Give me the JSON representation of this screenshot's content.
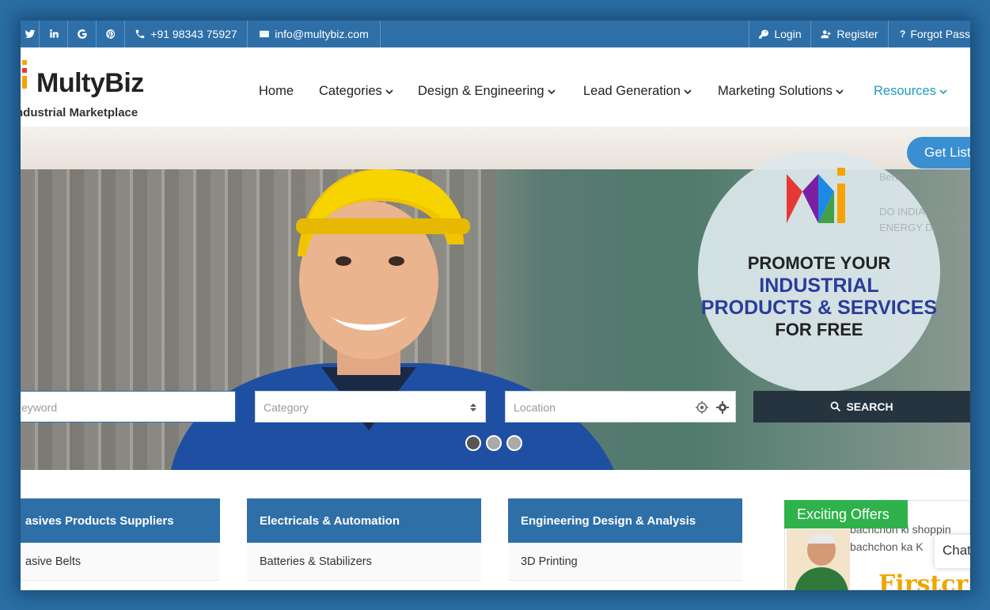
{
  "topbar": {
    "social": [
      "twitter-icon",
      "linkedin-icon",
      "google-icon",
      "pinterest-icon"
    ],
    "phone": "+91 98343 75927",
    "email": "info@multybiz.com",
    "login": "Login",
    "register": "Register",
    "forgot": "Forgot Pass"
  },
  "logo": {
    "title": "MultyBiz",
    "subtitle": "ndustrial Marketplace"
  },
  "nav": {
    "items": [
      "Home",
      "Categories",
      "Design & Engineering",
      "Lead Generation",
      "Marketing Solutions",
      "Resources"
    ]
  },
  "hero": {
    "promo": [
      "PROMOTE YOUR",
      "INDUSTRIAL",
      "PRODUCTS & SERVICES",
      "FOR FREE"
    ],
    "get_listed": "Get List",
    "faded": [
      "Benefit",
      "DO INDIA READY",
      "ENERGY DEMAND"
    ]
  },
  "search": {
    "keyword_placeholder": "eyword",
    "category_placeholder": "Category",
    "location_placeholder": "Location",
    "button": "SEARCH"
  },
  "categories": [
    {
      "title": "asives Products Suppliers",
      "first_item": "asive Belts"
    },
    {
      "title": "Electricals & Automation",
      "first_item": "Batteries & Stabilizers"
    },
    {
      "title": "Engineering Design & Analysis",
      "first_item": "3D Printing"
    }
  ],
  "offers": {
    "title": "Exciting Offers",
    "line1": "bachchon ki shoppin",
    "line2": "bachchon ka K",
    "chat": "Chat"
  },
  "colors": {
    "brand": "#2e6fa8",
    "accent": "#1f9bbf",
    "offers": "#2fb24b",
    "search_button": "#26343f"
  }
}
